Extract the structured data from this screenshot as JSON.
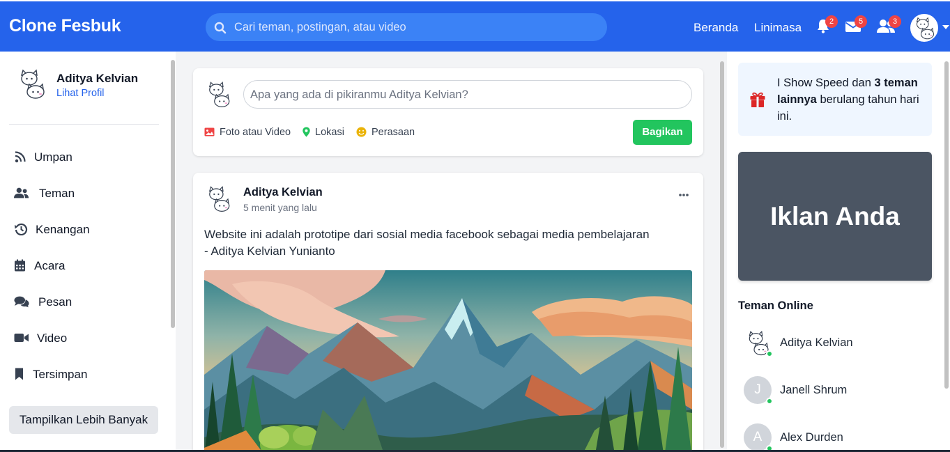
{
  "brand": "Clone Fesbuk",
  "search": {
    "placeholder": "Cari teman, postingan, atau video"
  },
  "nav": {
    "links": [
      "Beranda",
      "Linimasa"
    ],
    "notifications": {
      "icon": "bell-icon",
      "count": "2"
    },
    "messages": {
      "icon": "envelope-icon",
      "count": "5"
    },
    "friend_requests": {
      "icon": "user-friends-icon",
      "count": "3"
    }
  },
  "sidebar": {
    "profile": {
      "name": "Aditya Kelvian",
      "link": "Lihat Profil"
    },
    "items": [
      {
        "label": "Umpan",
        "icon": "rss-icon"
      },
      {
        "label": "Teman",
        "icon": "users-icon"
      },
      {
        "label": "Kenangan",
        "icon": "history-icon"
      },
      {
        "label": "Acara",
        "icon": "calendar-icon"
      },
      {
        "label": "Pesan",
        "icon": "comments-icon"
      },
      {
        "label": "Video",
        "icon": "video-icon"
      },
      {
        "label": "Tersimpan",
        "icon": "bookmark-icon"
      }
    ],
    "more_button": "Tampilkan Lebih Banyak"
  },
  "composer": {
    "placeholder": "Apa yang ada di pikiranmu Aditya Kelvian?",
    "actions": [
      {
        "label": "Foto atau Video",
        "icon": "image-icon"
      },
      {
        "label": "Lokasi",
        "icon": "map-marker-icon"
      },
      {
        "label": "Perasaan",
        "icon": "smile-icon"
      }
    ],
    "share_button": "Bagikan"
  },
  "post": {
    "author": "Aditya Kelvian",
    "time": "5 menit yang lalu",
    "text_line1": "Website ini adalah prototipe dari sosial media facebook sebagai media pembelajaran",
    "text_line2": "- Aditya Kelvian Yunianto"
  },
  "birthday": {
    "name": "I Show Speed",
    "middle": "dan",
    "others": "3 teman lainnya",
    "suffix": "berulang tahun hari ini."
  },
  "ad": {
    "text": "Iklan Anda"
  },
  "online": {
    "title": "Teman Online",
    "friends": [
      {
        "name": "Aditya Kelvian",
        "initial": ""
      },
      {
        "name": "Janell Shrum",
        "initial": "J"
      },
      {
        "name": "Alex Durden",
        "initial": "A"
      }
    ]
  },
  "colors": {
    "primary": "#2563eb",
    "search_bg": "#3b82f6",
    "share_green": "#22c55e",
    "badge_red": "#ef4444",
    "ad_bg": "#4b5563",
    "online_dot": "#22c55e"
  }
}
